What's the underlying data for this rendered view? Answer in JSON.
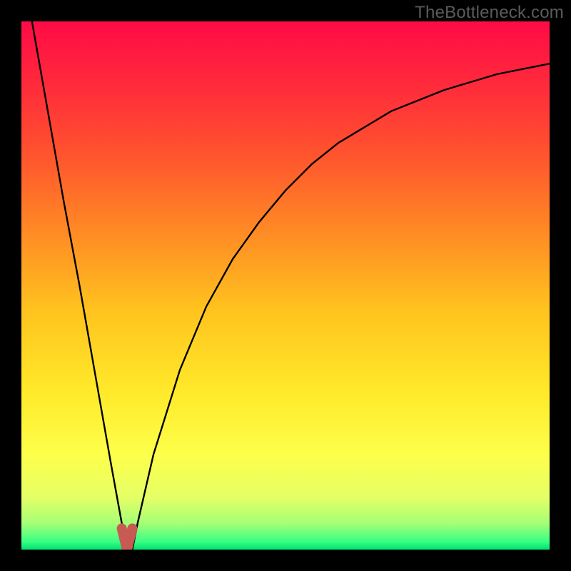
{
  "watermark": "TheBottleneck.com",
  "chart_data": {
    "type": "line",
    "title": "",
    "xlabel": "",
    "ylabel": "",
    "xlim": [
      0,
      100
    ],
    "ylim": [
      0,
      100
    ],
    "grid": false,
    "legend": false,
    "description": "V-shaped bottleneck curve over a vertical red-to-green gradient background. The curve drops steeply from top-left, reaches a minimum near x≈20 (bottleneck ~0), then rises with diminishing slope toward the top-right.",
    "series": [
      {
        "name": "bottleneck-curve",
        "x": [
          2,
          5,
          8,
          11,
          14,
          17,
          19,
          20,
          21,
          22,
          25,
          30,
          35,
          40,
          45,
          50,
          55,
          60,
          65,
          70,
          75,
          80,
          85,
          90,
          95,
          100
        ],
        "values": [
          100,
          83,
          66,
          50,
          33,
          16,
          5,
          0,
          0,
          5,
          18,
          34,
          46,
          55,
          62,
          68,
          73,
          77,
          80,
          83,
          85,
          87,
          88.5,
          90,
          91,
          92
        ]
      },
      {
        "name": "bottleneck-marker",
        "x": [
          19,
          20,
          21
        ],
        "values": [
          4,
          0,
          4
        ]
      }
    ],
    "background_gradient_stops": [
      {
        "pos": 0.0,
        "color": "#ff0b46"
      },
      {
        "pos": 0.12,
        "color": "#ff2a3b"
      },
      {
        "pos": 0.25,
        "color": "#ff532e"
      },
      {
        "pos": 0.4,
        "color": "#ff8b24"
      },
      {
        "pos": 0.55,
        "color": "#ffc41e"
      },
      {
        "pos": 0.7,
        "color": "#ffe92a"
      },
      {
        "pos": 0.82,
        "color": "#fdff4a"
      },
      {
        "pos": 0.9,
        "color": "#e6ff66"
      },
      {
        "pos": 0.95,
        "color": "#a6ff75"
      },
      {
        "pos": 0.985,
        "color": "#39ff84"
      },
      {
        "pos": 1.0,
        "color": "#00e06e"
      }
    ],
    "curve_stroke": "#000000",
    "curve_stroke_width": 2.4,
    "marker_stroke": "#c85a54",
    "marker_stroke_width": 14
  }
}
